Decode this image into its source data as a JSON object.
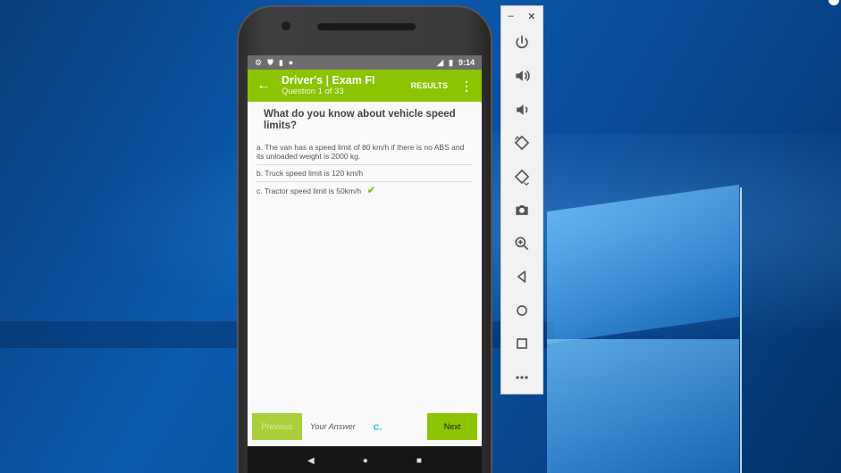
{
  "status_bar": {
    "time": "9:14"
  },
  "app_bar": {
    "title": "Driver's | Exam FI",
    "subtitle": "Question 1 of 33",
    "results_label": "RESULTS"
  },
  "question": {
    "text": "What do you know about vehicle speed limits?",
    "answers": [
      {
        "text": "a. The van has a speed limit of 80 km/h if there is no ABS and its unloaded weight is 2000 kg.",
        "checked": false
      },
      {
        "text": "b. Truck speed limit is 120 km/h",
        "checked": false
      },
      {
        "text": "c. Tractor speed limit is 50km/h",
        "checked": true
      }
    ]
  },
  "footer": {
    "previous_label": "Previous",
    "your_answer_label": "Your Answer",
    "your_answer_value": "c.",
    "next_label": "Next"
  },
  "emulator": {
    "buttons": [
      "power-icon",
      "volume-up-icon",
      "volume-down-icon",
      "rotate-left-icon",
      "rotate-right-icon",
      "camera-icon",
      "zoom-icon",
      "back-icon",
      "home-icon",
      "overview-icon",
      "more-icon"
    ]
  },
  "colors": {
    "accent": "#8bc400",
    "answer_value": "#26c8e6",
    "check": "#6cc000"
  }
}
